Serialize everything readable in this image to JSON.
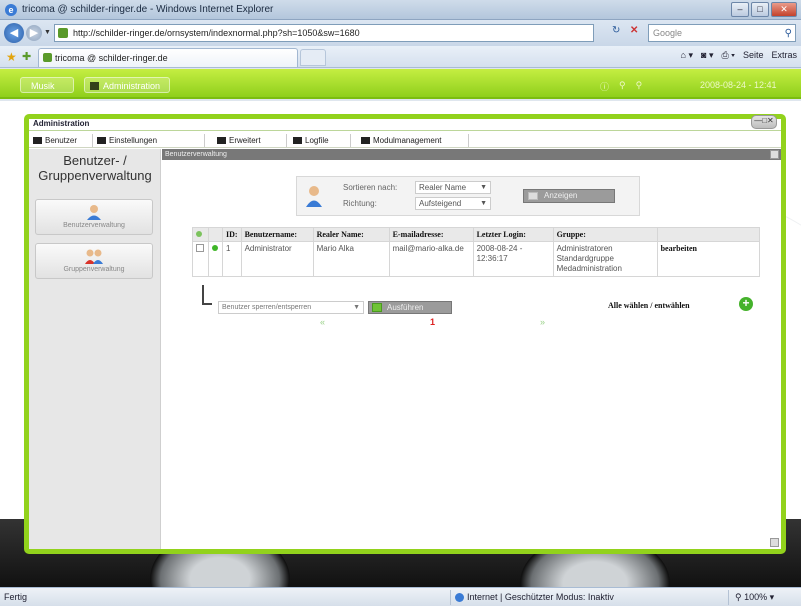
{
  "browser": {
    "window_title": "tricoma @ schilder-ringer.de - Windows Internet Explorer",
    "url": "http://schilder-ringer.de/ornsystem/indexnormal.php?sh=1050&sw=1680",
    "search_placeholder": "Google",
    "tab_title": "tricoma @ schilder-ringer.de",
    "command_bar": [
      "Seite",
      "Extras"
    ],
    "status_text": "Fertig",
    "zone_text": "Internet | Geschützter Modus: Inaktiv",
    "zoom": "100%"
  },
  "app": {
    "top_tabs": [
      "Musik",
      "Administration"
    ],
    "datetime": "2008-08-24 - 12:41"
  },
  "admin": {
    "window_title": "Administration",
    "menu": [
      "Benutzer",
      "Einstellungen",
      "Erweitert",
      "Logfile",
      "Modulmanagement"
    ],
    "sidebar": {
      "title": "Benutzer- / Gruppenverwaltung",
      "items": [
        {
          "label": "Benutzerverwaltung"
        },
        {
          "label": "Gruppenverwaltung"
        }
      ]
    },
    "content": {
      "header": "Benutzerverwaltung",
      "sort_label": "Sortieren nach:",
      "sort_value": "Realer Name",
      "direction_label": "Richtung:",
      "direction_value": "Aufsteigend",
      "show_button": "Anzeigen",
      "table": {
        "headers": [
          "",
          "",
          "ID:",
          "Benutzername:",
          "Realer Name:",
          "E-mailadresse:",
          "Letzter Login:",
          "Gruppe:",
          ""
        ],
        "rows": [
          {
            "id": "1",
            "username": "Administrator",
            "realname": "Mario Alka",
            "email": "mail@mario-alka.de",
            "last_login": "2008-08-24 - 12:36:17",
            "groups": "Administratoren Standardgruppe Medadministration",
            "action": "bearbeiten"
          }
        ]
      },
      "bulk_select": "Benutzer sperren/entsperren",
      "execute_button": "Ausführen",
      "select_all": "Alle wählen / entwählen",
      "pager": {
        "prev": "«",
        "current": "1",
        "next": "»"
      }
    }
  }
}
